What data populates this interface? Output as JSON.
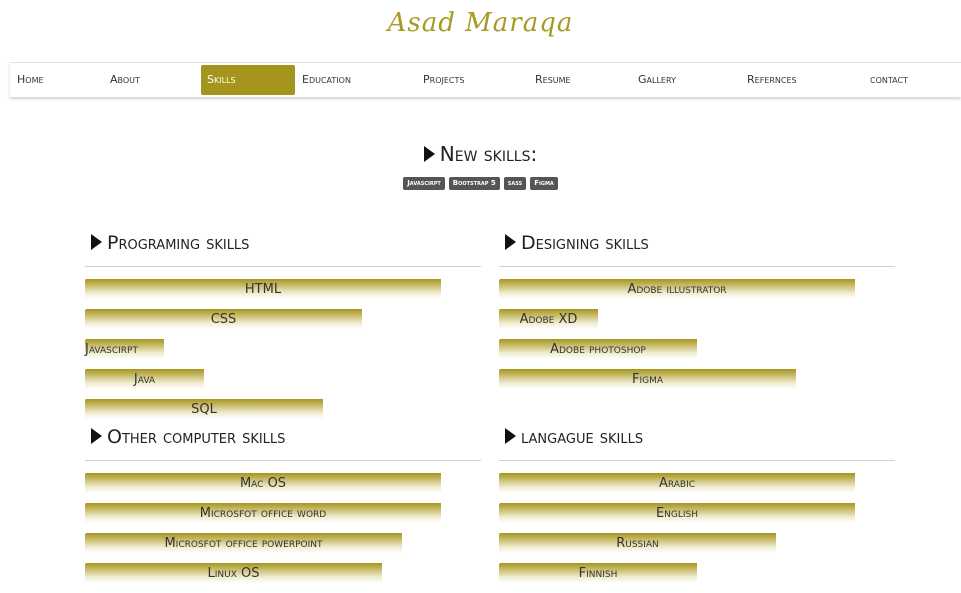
{
  "brand": "Asad Maraqa",
  "nav": {
    "items": [
      "Home",
      "About",
      "Skills",
      "Education",
      "Projects",
      "Resume",
      "Gallery",
      "Refernces",
      "contact"
    ],
    "active": "Skills"
  },
  "new_skills": {
    "title": "New skills:",
    "badges": [
      "Javascirpt",
      "Bootstrap 5",
      "sass",
      "Figma"
    ]
  },
  "sections": {
    "programming": {
      "title": "Programing skills",
      "skills": [
        {
          "name": "HTML",
          "level": 0.9
        },
        {
          "name": "CSS",
          "level": 0.7
        },
        {
          "name": "Javascirpt",
          "level": 0.2
        },
        {
          "name": "Java",
          "level": 0.3
        },
        {
          "name": "SQL",
          "level": 0.6
        }
      ]
    },
    "designing": {
      "title": "Designing skills",
      "skills": [
        {
          "name": "Adobe illustrator",
          "level": 0.9
        },
        {
          "name": "Adobe XD",
          "level": 0.25
        },
        {
          "name": "Adobe photoshop",
          "level": 0.5
        },
        {
          "name": "Figma",
          "level": 0.75
        }
      ]
    },
    "other": {
      "title": "Other computer skills",
      "skills": [
        {
          "name": "Mac OS",
          "level": 0.9
        },
        {
          "name": "Microsfot office word",
          "level": 0.9
        },
        {
          "name": "Microsfot office powerpoint",
          "level": 0.8
        },
        {
          "name": "Linux OS",
          "level": 0.75
        }
      ]
    },
    "language": {
      "title": "langague skills",
      "skills": [
        {
          "name": "Arabic",
          "level": 0.9
        },
        {
          "name": "English",
          "level": 0.9
        },
        {
          "name": "Russian",
          "level": 0.7
        },
        {
          "name": "Finnish",
          "level": 0.5
        }
      ]
    }
  }
}
